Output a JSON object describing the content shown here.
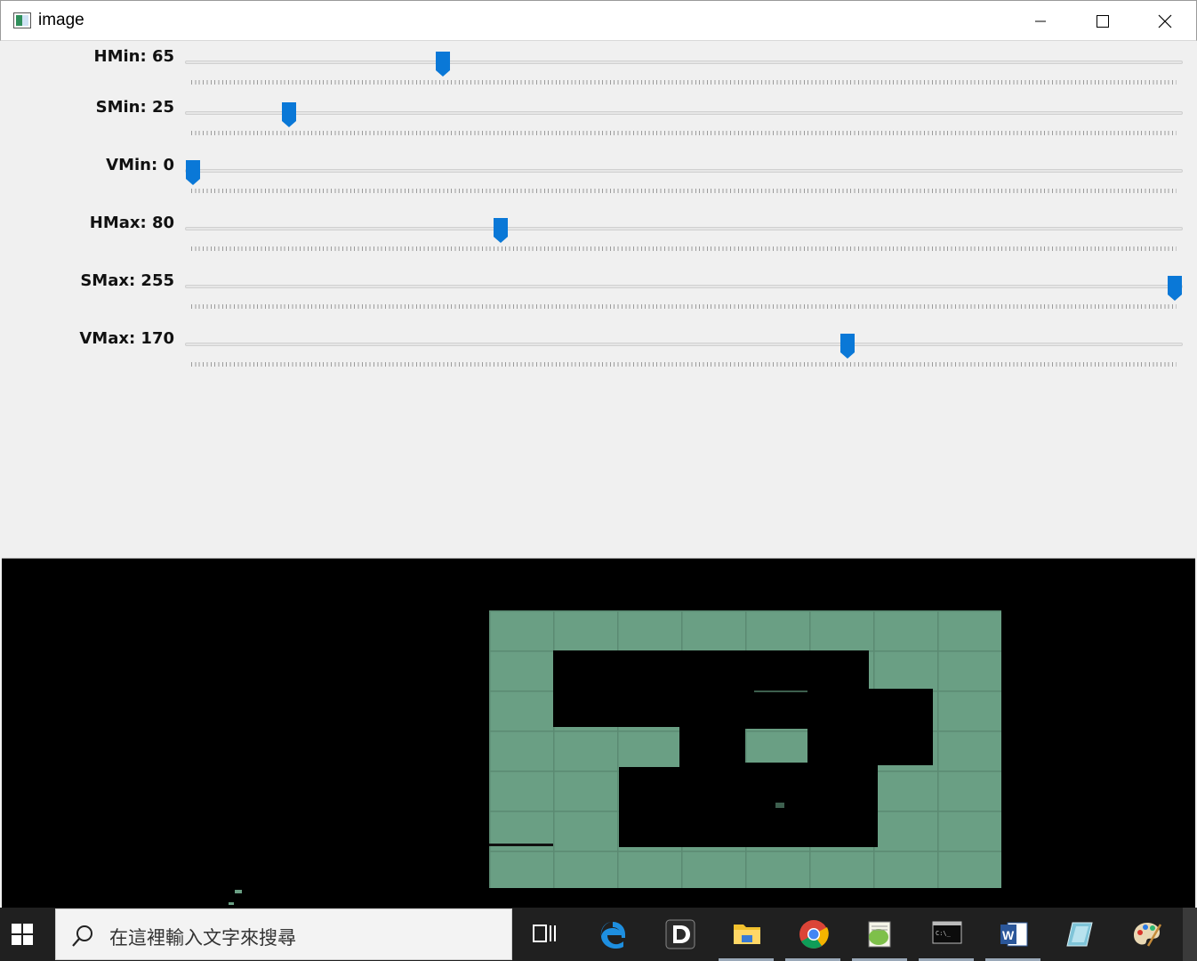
{
  "window": {
    "title": "image",
    "controls": [
      "minimize",
      "maximize",
      "close"
    ]
  },
  "trackbars": [
    {
      "label": "HMin: 65",
      "name": "HMin",
      "value": 65,
      "max": 255
    },
    {
      "label": "SMin: 25",
      "name": "SMin",
      "value": 25,
      "max": 255
    },
    {
      "label": "VMin: 0",
      "name": "VMin",
      "value": 0,
      "max": 255
    },
    {
      "label": "HMax: 80",
      "name": "HMax",
      "value": 80,
      "max": 255
    },
    {
      "label": "SMax: 255",
      "name": "SMax",
      "value": 255,
      "max": 255
    },
    {
      "label": "VMax: 170",
      "name": "VMax",
      "value": 170,
      "max": 255
    }
  ],
  "colors": {
    "thumb": "#0a78d7",
    "mask_green": "#6a9f84",
    "taskbar": "#202020"
  },
  "taskbar": {
    "search_placeholder": "在這裡輸入文字來搜尋",
    "apps": [
      "task-view",
      "edge",
      "d-app",
      "file-explorer",
      "chrome",
      "notepad-plus-plus",
      "command-prompt",
      "word",
      "notes",
      "paint"
    ]
  }
}
